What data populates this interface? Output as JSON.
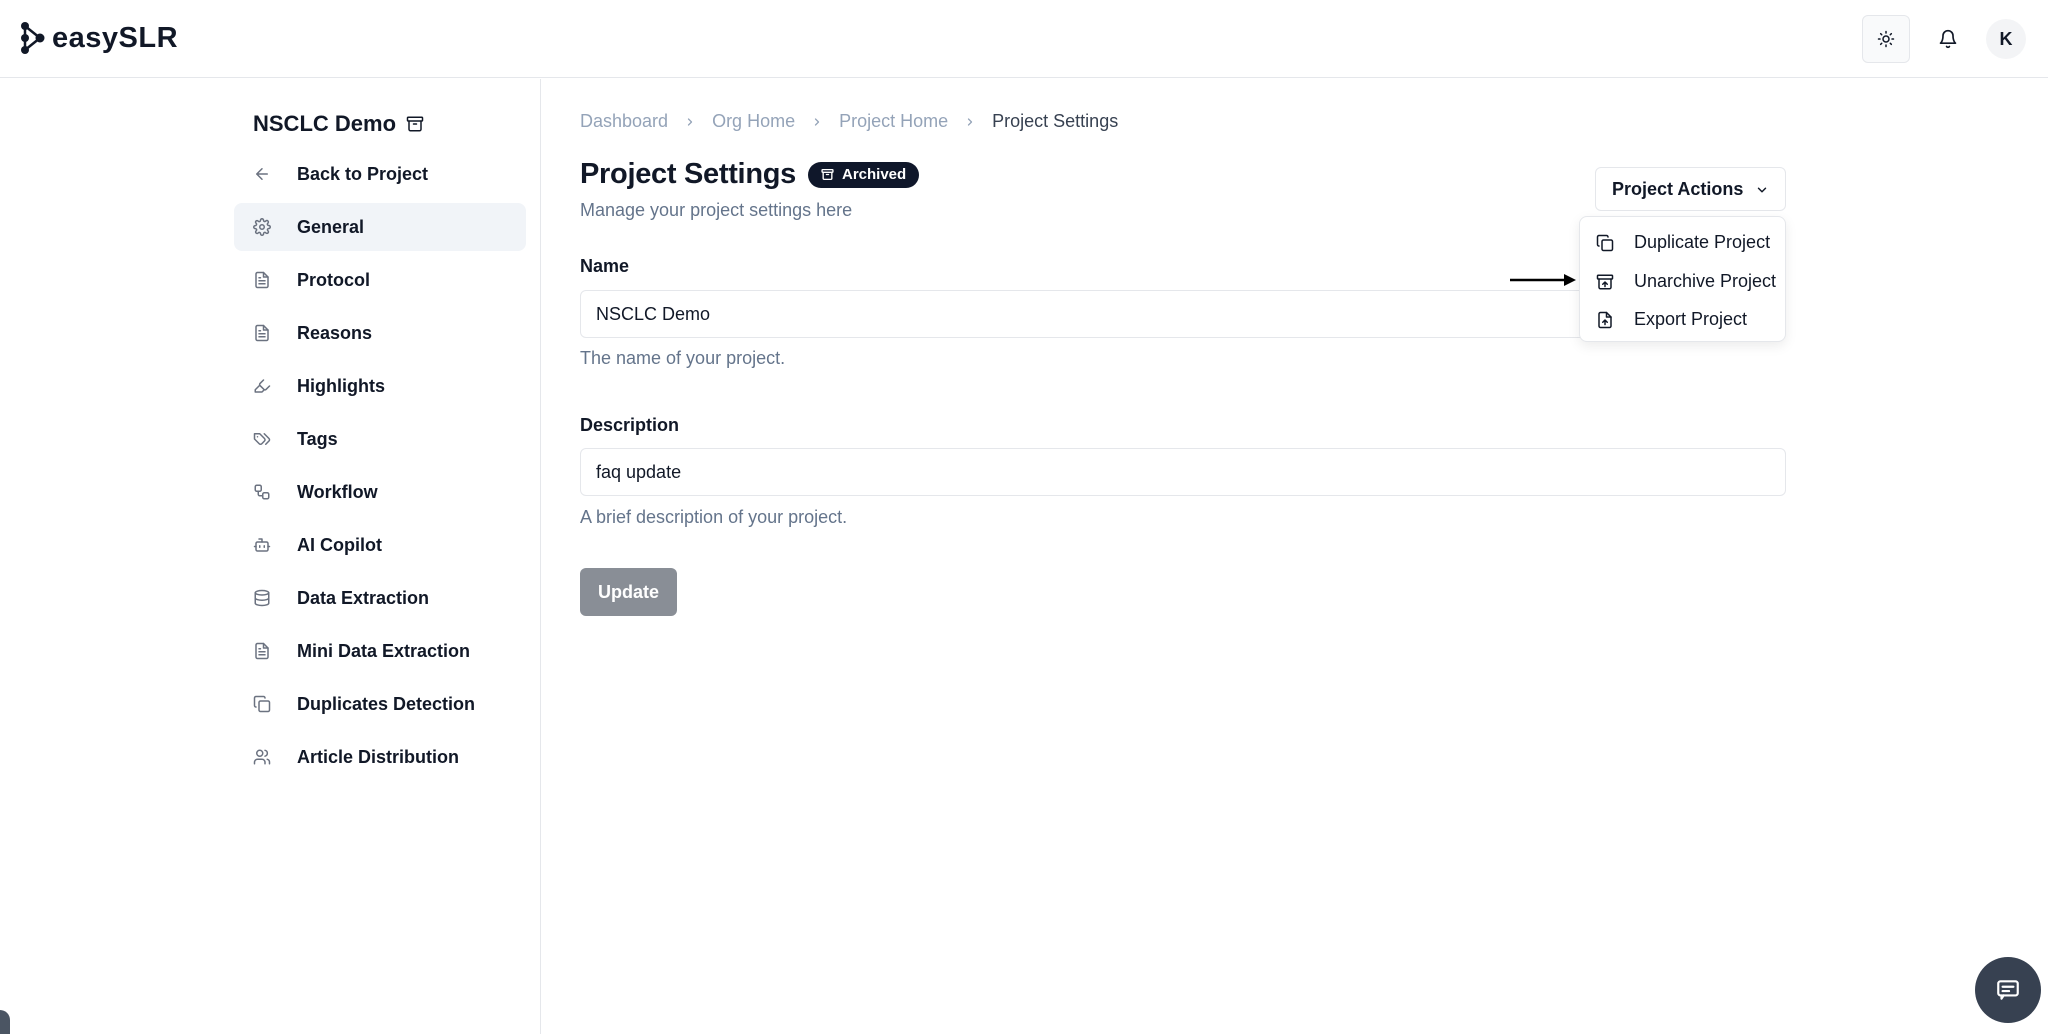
{
  "app": {
    "name": "easySLR"
  },
  "header": {
    "avatar_initial": "K"
  },
  "sidebar": {
    "project_name": "NSCLC Demo",
    "back_label": "Back to Project",
    "items": [
      {
        "label": "General",
        "icon": "gear-icon",
        "active": true
      },
      {
        "label": "Protocol",
        "icon": "document-icon"
      },
      {
        "label": "Reasons",
        "icon": "document-icon"
      },
      {
        "label": "Highlights",
        "icon": "highlighter-icon"
      },
      {
        "label": "Tags",
        "icon": "tags-icon"
      },
      {
        "label": "Workflow",
        "icon": "workflow-icon"
      },
      {
        "label": "AI Copilot",
        "icon": "bot-icon"
      },
      {
        "label": "Data Extraction",
        "icon": "database-icon"
      },
      {
        "label": "Mini Data Extraction",
        "icon": "document-icon"
      },
      {
        "label": "Duplicates Detection",
        "icon": "copy-icon"
      },
      {
        "label": "Article Distribution",
        "icon": "users-icon"
      }
    ]
  },
  "breadcrumb": [
    "Dashboard",
    "Org Home",
    "Project Home",
    "Project Settings"
  ],
  "page": {
    "title": "Project Settings",
    "badge": "Archived",
    "subtitle": "Manage your project settings here"
  },
  "form": {
    "name_label": "Name",
    "name_value": "NSCLC Demo",
    "name_help": "The name of your project.",
    "description_label": "Description",
    "description_value": "faq update",
    "description_help": "A brief description of your project.",
    "update_label": "Update"
  },
  "actions": {
    "button_label": "Project Actions",
    "menu": [
      {
        "label": "Duplicate Project",
        "icon": "copy-icon"
      },
      {
        "label": "Unarchive Project",
        "icon": "unarchive-icon"
      },
      {
        "label": "Export Project",
        "icon": "file-export-icon"
      }
    ]
  },
  "colors": {
    "badge_bg": "#0f172a",
    "active_nav_bg": "#f1f4f8",
    "update_button_bg": "#898e96",
    "muted_text": "#64748b"
  }
}
